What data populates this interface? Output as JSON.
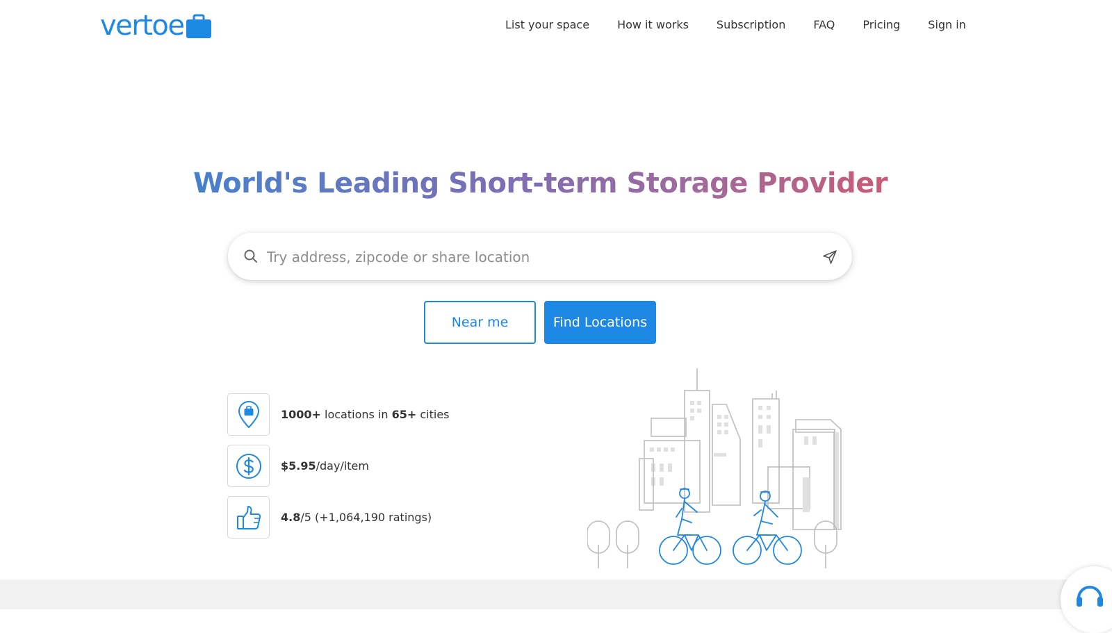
{
  "header": {
    "logo_text": "vertoe",
    "nav": [
      {
        "label": "List your space"
      },
      {
        "label": "How it works"
      },
      {
        "label": "Subscription"
      },
      {
        "label": "FAQ"
      },
      {
        "label": "Pricing"
      },
      {
        "label": "Sign in"
      }
    ]
  },
  "hero": {
    "title": "World's Leading Short-term Storage Provider",
    "search": {
      "placeholder": "Try address, zipcode or share location",
      "value": ""
    },
    "buttons": {
      "near_me": "Near me",
      "find_locations": "Find Locations"
    }
  },
  "features": [
    {
      "icon": "location-pin-bag-icon",
      "strong": "1000+",
      "text1": " locations in ",
      "strong2": "65+",
      "text2": " cities"
    },
    {
      "icon": "dollar-icon",
      "strong": "$5.95",
      "text1": "/day/item"
    },
    {
      "icon": "thumbs-up-icon",
      "strong": "4.8",
      "text1": "/5 (+1,064,190 ratings)"
    }
  ],
  "colors": {
    "brand": "#1e88e5",
    "title_gradient_start": "#1f7fd6",
    "title_gradient_end": "#d0586f",
    "footer_band": "#f2f2f2"
  },
  "icons": {
    "search": "search-icon",
    "locate": "navigation-arrow-icon",
    "chat": "headset-icon"
  }
}
